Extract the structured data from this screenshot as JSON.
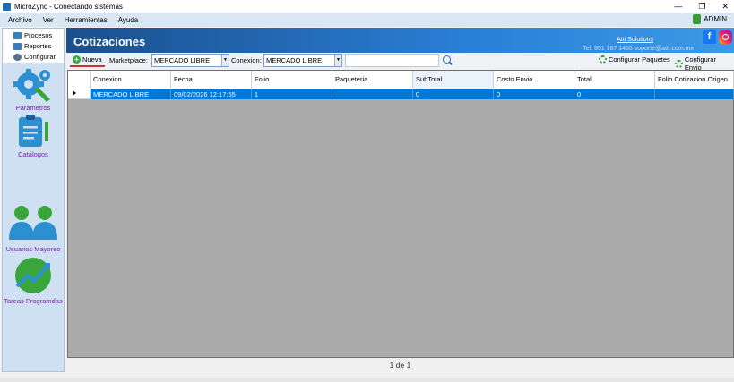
{
  "window": {
    "title": "MicroZync - Conectando sistemas",
    "min": "—",
    "restore": "❐",
    "close": "✕"
  },
  "menu": {
    "items": [
      "Archivo",
      "Ver",
      "Herramientas",
      "Ayuda"
    ],
    "user": "ADMIN"
  },
  "sidebar": {
    "links": [
      "Procesos",
      "Reportes",
      "Configurar"
    ],
    "modules": [
      "Parámetros",
      "Catálogos",
      "Usuarios Mayoreo",
      "Tareas Programdas"
    ]
  },
  "header": {
    "title": "Cotizaciones",
    "company": "Atti Solutions",
    "contact": "Tel. 951 167 1455  soporte@atti.com.mx",
    "facebook": "f"
  },
  "toolbar": {
    "new_label": "Nueva",
    "marketplace_label": "Marketplace:",
    "marketplace_value": "MERCADO LIBRE",
    "conexion_label": "Conexion:",
    "conexion_value": "MERCADO LIBRE",
    "config_paquetes": "Configurar Paquetes",
    "config_envio": "Configurar Envio"
  },
  "table": {
    "columns": [
      "Conexion",
      "Fecha",
      "Folio",
      "Paqueteria",
      "SubTotal",
      "Costo Envio",
      "Total",
      "Folio Cotizacion Origen"
    ],
    "rows": [
      [
        "MERCADO LIBRE",
        "09/02/2026 12:17:55",
        "1",
        "",
        "0",
        "0",
        "0",
        ""
      ]
    ]
  },
  "pager": "1 de 1",
  "colors": {
    "accent": "#0078d7",
    "header": "#1b4f8c",
    "module_label": "#7a1fa8"
  }
}
